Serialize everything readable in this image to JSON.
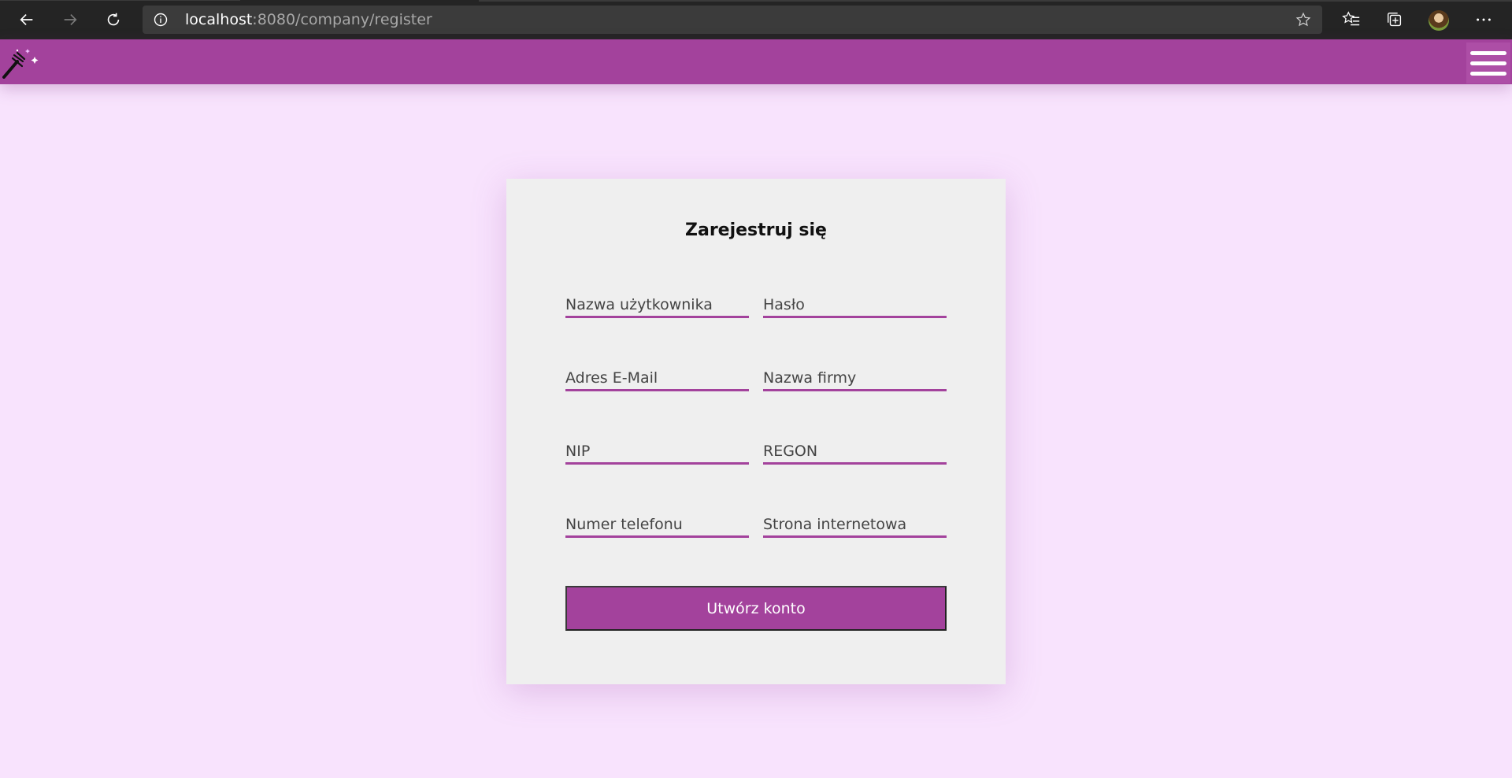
{
  "browser": {
    "url_host": "localhost",
    "url_path": ":8080/company/register",
    "icons": [
      "back-arrow-icon",
      "forward-arrow-icon",
      "refresh-icon",
      "info-icon",
      "star-icon",
      "favorites-icon",
      "collections-icon",
      "profile-avatar",
      "more-icon"
    ]
  },
  "header": {
    "logo": "magic-wand-icon",
    "menu": "hamburger-menu-icon",
    "color": "#a3429c"
  },
  "form": {
    "title": "Zarejestruj się",
    "fields": {
      "username": "Nazwa użytkownika",
      "password": "Hasło",
      "email": "Adres E-Mail",
      "company": "Nazwa firmy",
      "nip": "NIP",
      "regon": "REGON",
      "phone": "Numer telefonu",
      "website": "Strona internetowa"
    },
    "submit_label": "Utwórz konto"
  },
  "colors": {
    "accent": "#a3429c",
    "page_background": "#f8e3fd",
    "card_background": "#efefef"
  }
}
